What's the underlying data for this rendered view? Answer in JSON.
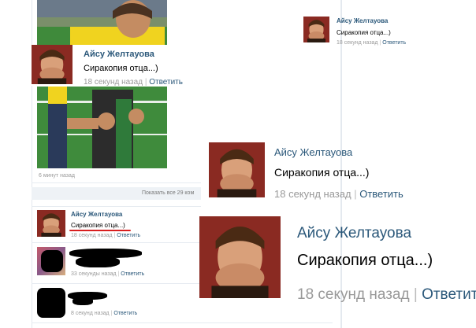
{
  "feed": {
    "post_time": "6 минут назад",
    "show_all": "Показать все 29 ком"
  },
  "comment": {
    "name": "Айсу Желтауова",
    "text": "Сиракопия отца...)",
    "time": "18 секунд назад",
    "reply": "Ответить",
    "separator": "|"
  },
  "comments_list": [
    {
      "time": "33 секунды назад",
      "reply": "Ответить"
    },
    {
      "time": "8 секунд назад",
      "reply": "Ответить"
    }
  ],
  "colors": {
    "link": "#2b587a",
    "meta": "#999999",
    "highlight_underline": "#d81e1e",
    "censor": "#000000"
  }
}
